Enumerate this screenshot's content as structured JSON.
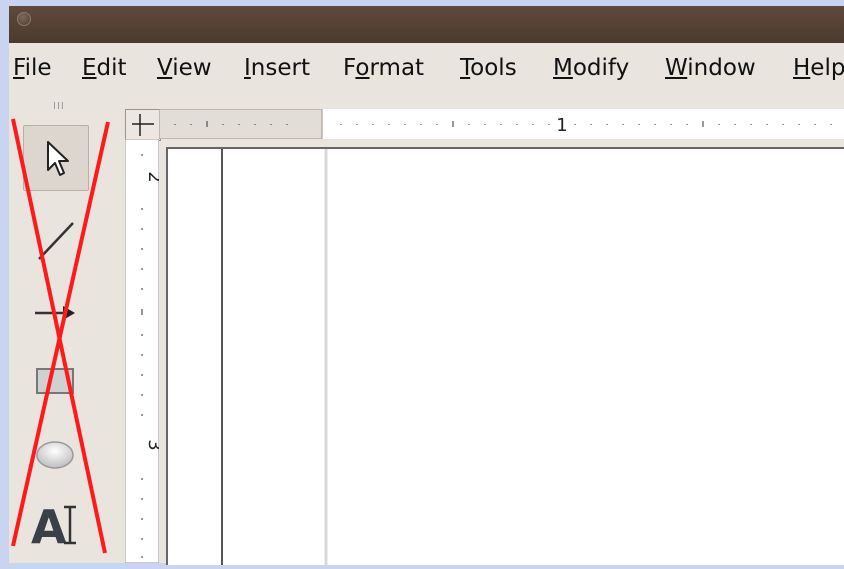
{
  "menubar": {
    "items": [
      {
        "label_u": "F",
        "label_rest": "ile"
      },
      {
        "label_u": "E",
        "label_rest": "dit"
      },
      {
        "label_u": "V",
        "label_rest": "iew"
      },
      {
        "label_u": "I",
        "label_rest": "nsert"
      },
      {
        "label_pre": "F",
        "label_u": "o",
        "label_rest": "rmat"
      },
      {
        "label_u": "T",
        "label_rest": "ools"
      },
      {
        "label_u": "M",
        "label_rest": "odify"
      },
      {
        "label_u": "W",
        "label_rest": "indow"
      },
      {
        "label_u": "H",
        "label_rest": "elp"
      }
    ]
  },
  "toolbar": {
    "grip": "III",
    "text_tool_glyph": "A"
  },
  "rulers": {
    "horizontal_number": "1",
    "vertical_numbers": [
      "2",
      "3"
    ]
  },
  "colors": {
    "titlebar": "#4f3e31",
    "menubar": "#e9e4de",
    "cross_out": "#ff1a1a",
    "desktop": "#c9d4f0"
  }
}
